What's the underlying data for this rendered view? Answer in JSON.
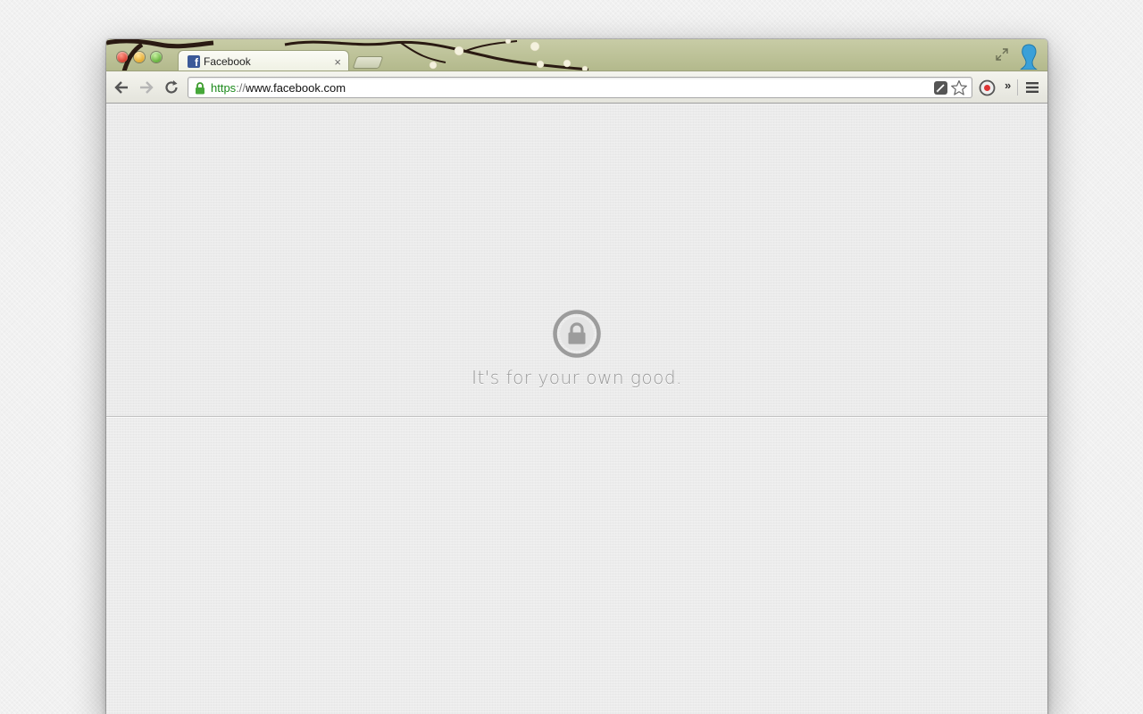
{
  "browser": {
    "tab": {
      "title": "Facebook",
      "favicon_letter": "f",
      "close_glyph": "×"
    },
    "address_bar": {
      "scheme": "https",
      "separator": "://",
      "host": "www.facebook.com",
      "secure_icon": "lock-icon"
    },
    "toolbar": {
      "overflow_glyph": "»"
    }
  },
  "blocked_page": {
    "icon": "lock-icon",
    "message": "It's for your own good."
  },
  "colors": {
    "secure_scheme": "#1c8a1c",
    "facebook_blue": "#3b5998",
    "message_gray": "#9a9a9a"
  }
}
